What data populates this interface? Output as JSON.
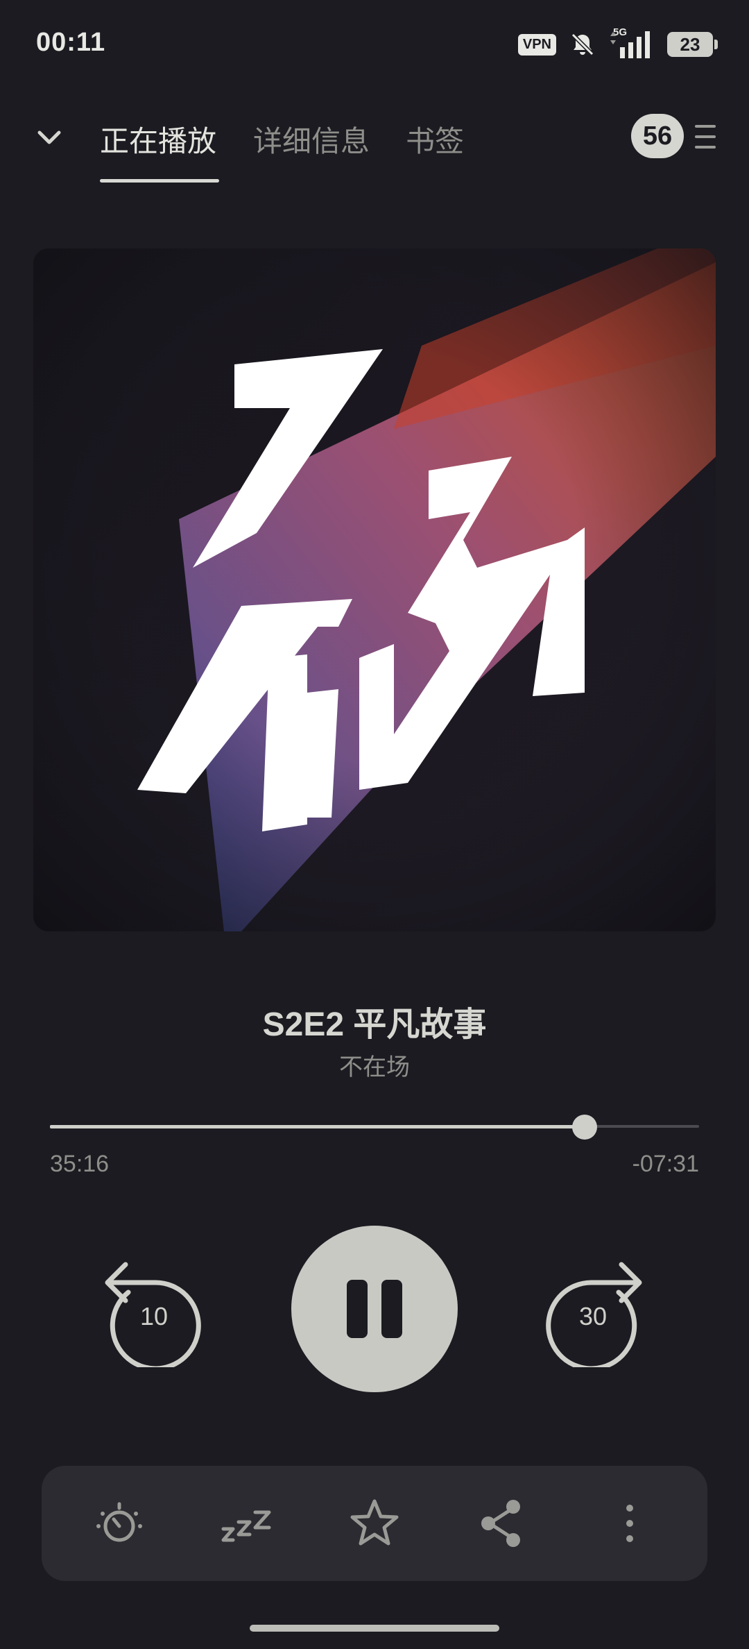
{
  "status_bar": {
    "time": "00:11",
    "vpn_label": "VPN",
    "network_label": "5G",
    "battery_level": "23"
  },
  "nav": {
    "tabs": [
      {
        "label": "正在播放",
        "active": true
      },
      {
        "label": "详细信息",
        "active": false
      },
      {
        "label": "书签",
        "active": false
      }
    ],
    "queue_count": "56"
  },
  "episode": {
    "title": "S2E2 平凡故事",
    "podcast": "不在场"
  },
  "playback": {
    "elapsed": "35:16",
    "remaining": "-07:31",
    "progress_fraction": 0.824,
    "skip_back_seconds": "10",
    "skip_forward_seconds": "30",
    "state": "playing"
  },
  "toolbar": {
    "items": [
      "sleep-timer-icon",
      "sleep-icon",
      "star-icon",
      "share-icon",
      "more-vertical-icon"
    ]
  },
  "colors": {
    "background": "#1b1b21",
    "accent": "#c9c9c4",
    "toolbar": "#2b2b31",
    "muted_text": "#8e8e8a"
  }
}
